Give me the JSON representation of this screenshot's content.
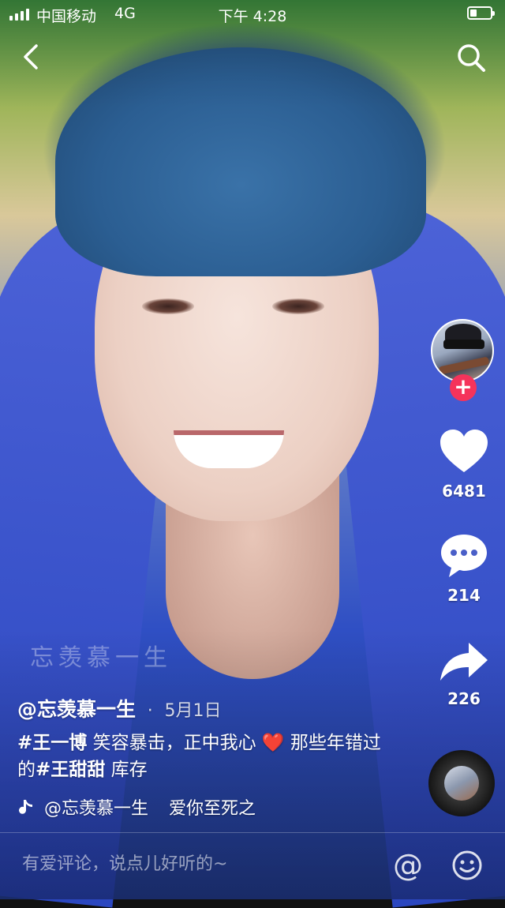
{
  "status_bar": {
    "carrier": "中国移动",
    "network": "4G",
    "time": "下午 4:28"
  },
  "nav": {
    "back_icon": "chevron-left-icon",
    "search_icon": "search-icon"
  },
  "right_rail": {
    "follow_label": "+",
    "likes": "6481",
    "comments": "214",
    "shares": "226",
    "accent_color": "#f5335b"
  },
  "video": {
    "watermark": "忘羡慕一生",
    "author": "@忘羡慕一生",
    "date_sep": "·",
    "date": "5月1日",
    "caption": {
      "tag1": "#王一博",
      "text1": " 笑容暴击，正中我心 ",
      "emoji": "❤️",
      "text2": " 那些年错过的",
      "tag2": "#王甜甜",
      "text3": " 库存"
    },
    "music": {
      "author": "@忘羡慕一生",
      "title": "爱你至死之"
    }
  },
  "comment_bar": {
    "placeholder": "有爱评论，说点儿好听的~",
    "at_label": "@"
  }
}
